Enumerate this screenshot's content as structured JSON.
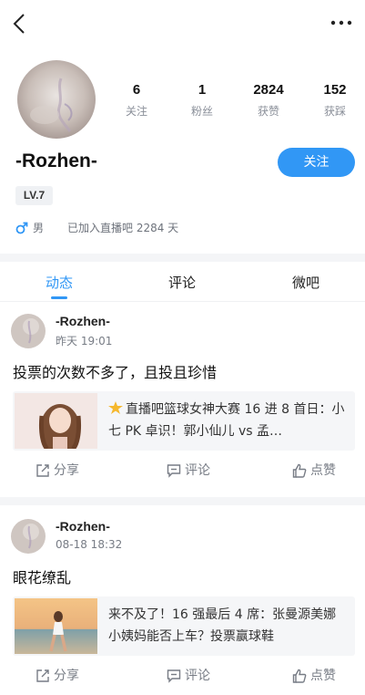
{
  "header": {
    "back_icon": "chevron-left-icon",
    "more_icon": "more-dots-icon"
  },
  "profile": {
    "username": "-Rozhen-",
    "follow_label": "关注",
    "level": "LV.7",
    "gender_icon": "male-icon",
    "gender": "男",
    "joined": "已加入直播吧 2284 天",
    "stats": [
      {
        "value": "6",
        "label": "关注"
      },
      {
        "value": "1",
        "label": "粉丝"
      },
      {
        "value": "2824",
        "label": "获赞"
      },
      {
        "value": "152",
        "label": "获踩"
      }
    ]
  },
  "tabs": [
    {
      "label": "动态",
      "active": true
    },
    {
      "label": "评论",
      "active": false
    },
    {
      "label": "微吧",
      "active": false
    }
  ],
  "posts": [
    {
      "user": "-Rozhen-",
      "time": "昨天 19:01",
      "text": "投票的次数不多了，且投且珍惜",
      "card_icon": "star-icon",
      "card_text": "直播吧篮球女神大赛 16 进 8 首日：小七 PK 卓识！郭小仙儿 vs 孟…"
    },
    {
      "user": "-Rozhen-",
      "time": "08-18 18:32",
      "text": "眼花缭乱",
      "card_text": "来不及了！16 强最后 4 席：张曼源美娜小姨妈能否上车？投票赢球鞋"
    }
  ],
  "actions": {
    "share": "分享",
    "comment": "评论",
    "like": "点赞"
  },
  "colors": {
    "accent": "#3197f5",
    "divider": "#f4f5f7"
  }
}
